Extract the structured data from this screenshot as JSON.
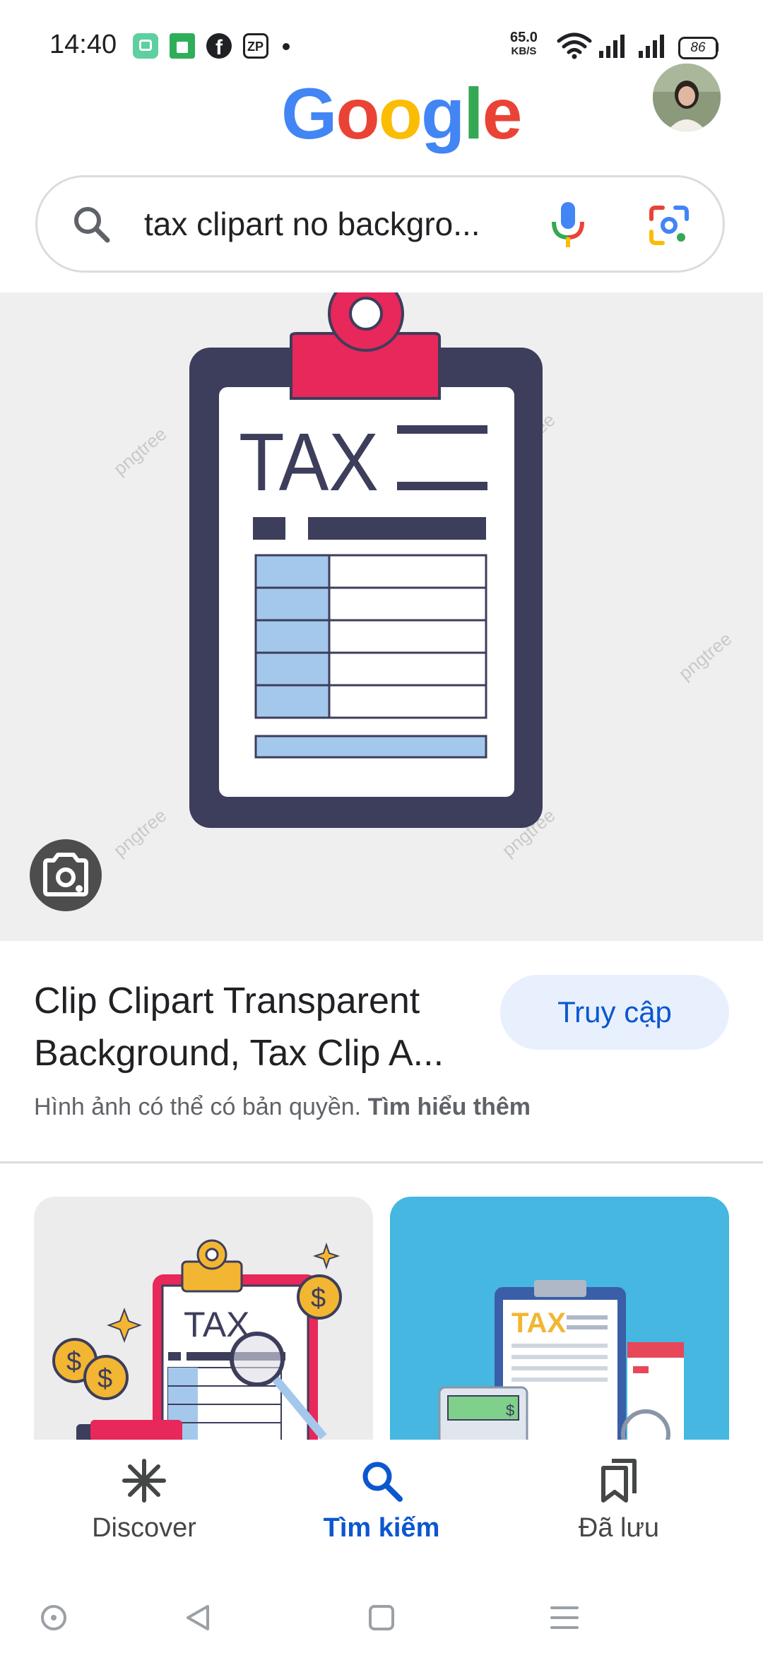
{
  "status_bar": {
    "time": "14:40",
    "apps": [
      "chat-app-icon",
      "shop-app-icon",
      "facebook-icon",
      "zp-app-icon"
    ],
    "network_speed_value": "65.0",
    "network_speed_unit": "KB/S",
    "battery": "86"
  },
  "header": {
    "logo_letters": [
      {
        "ch": "G",
        "color": "#4285F4"
      },
      {
        "ch": "o",
        "color": "#EA4335"
      },
      {
        "ch": "o",
        "color": "#FBBC05"
      },
      {
        "ch": "g",
        "color": "#4285F4"
      },
      {
        "ch": "l",
        "color": "#34A853"
      },
      {
        "ch": "e",
        "color": "#EA4335"
      }
    ]
  },
  "search": {
    "query": "tax clipart no backgro..."
  },
  "hero_image": {
    "clipboard_text": "TAX",
    "watermark": "pngtree"
  },
  "result": {
    "title": "Clip Clipart Transparent Background, Tax Clip A...",
    "visit_label": "Truy cập",
    "copyright_text": "Hình ảnh có thể có bản quyền.",
    "learn_more": "Tìm hiểu thêm"
  },
  "related": [
    {
      "label": "TAX",
      "bg": "#ececec"
    },
    {
      "label": "TAX",
      "bg": "#45b7e0"
    }
  ],
  "bottom_nav": {
    "items": [
      {
        "label": "Discover",
        "active": false
      },
      {
        "label": "Tìm kiếm",
        "active": true
      },
      {
        "label": "Đã lưu",
        "active": false
      }
    ]
  },
  "colors": {
    "accent": "#0b57d0",
    "navy": "#3d3d5c",
    "pink": "#e8275a",
    "light_blue": "#a4c8ec"
  }
}
